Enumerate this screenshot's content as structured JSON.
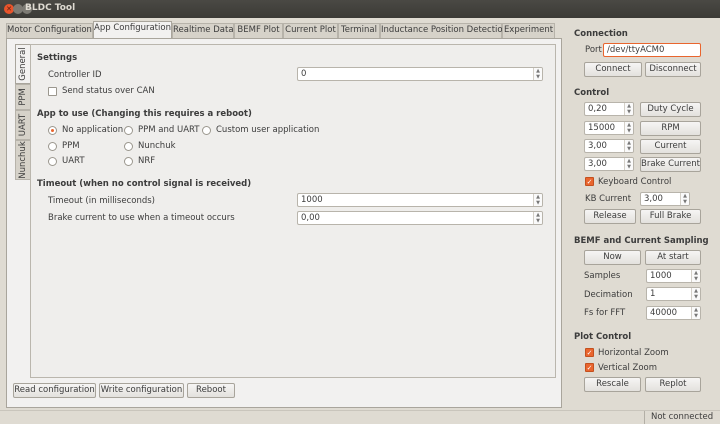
{
  "window": {
    "title": "BLDC Tool"
  },
  "tabs": [
    "Motor Configuration",
    "App Configuration",
    "Realtime Data",
    "BEMF Plot",
    "Current Plot",
    "Terminal",
    "Inductance Position Detection",
    "Experiment"
  ],
  "side_tabs": [
    "General",
    "PPM",
    "UART",
    "Nunchuk"
  ],
  "settings": {
    "heading": "Settings",
    "controller_id_label": "Controller ID",
    "controller_id_value": "0",
    "send_status_label": "Send status over CAN",
    "send_status_checked": false
  },
  "app_to_use": {
    "heading": "App to use (Changing this requires a reboot)",
    "options": [
      "No application",
      "PPM and UART",
      "Custom user application",
      "PPM",
      "Nunchuk",
      "UART",
      "NRF"
    ],
    "selected": "No application"
  },
  "timeout": {
    "heading": "Timeout (when no control signal is received)",
    "timeout_label": "Timeout (in milliseconds)",
    "timeout_value": "1000",
    "brake_label": "Brake current to use when a timeout occurs",
    "brake_value": "0,00"
  },
  "bottom_buttons": {
    "read": "Read configuration",
    "write": "Write configuration",
    "reboot": "Reboot"
  },
  "connection": {
    "heading": "Connection",
    "port_label": "Port",
    "port_value": "/dev/ttyACM0",
    "connect": "Connect",
    "disconnect": "Disconnect"
  },
  "control": {
    "heading": "Control",
    "duty_value": "0,20",
    "duty_button": "Duty Cycle",
    "rpm_value": "15000",
    "rpm_button": "RPM",
    "current_value": "3,00",
    "current_button": "Current",
    "brake_value": "3,00",
    "brake_button": "Brake Current",
    "keyboard_label": "Keyboard Control",
    "keyboard_checked": true,
    "kb_current_label": "KB Current",
    "kb_current_value": "3,00",
    "release": "Release",
    "full_brake": "Full Brake"
  },
  "sampling": {
    "heading": "BEMF and Current Sampling",
    "now": "Now",
    "at_start": "At start",
    "samples_label": "Samples",
    "samples_value": "1000",
    "decimation_label": "Decimation",
    "decimation_value": "1",
    "fs_label": "Fs for FFT",
    "fs_value": "40000"
  },
  "plot_control": {
    "heading": "Plot Control",
    "hzoom_label": "Horizontal Zoom",
    "vzoom_label": "Vertical Zoom",
    "hzoom_checked": true,
    "vzoom_checked": true,
    "rescale": "Rescale",
    "replot": "Replot"
  },
  "status": {
    "text": "Not connected"
  },
  "colors": {
    "accent": "#e9652e",
    "titlebar": "#3b3a36",
    "window_bg": "#dfdbd2"
  }
}
